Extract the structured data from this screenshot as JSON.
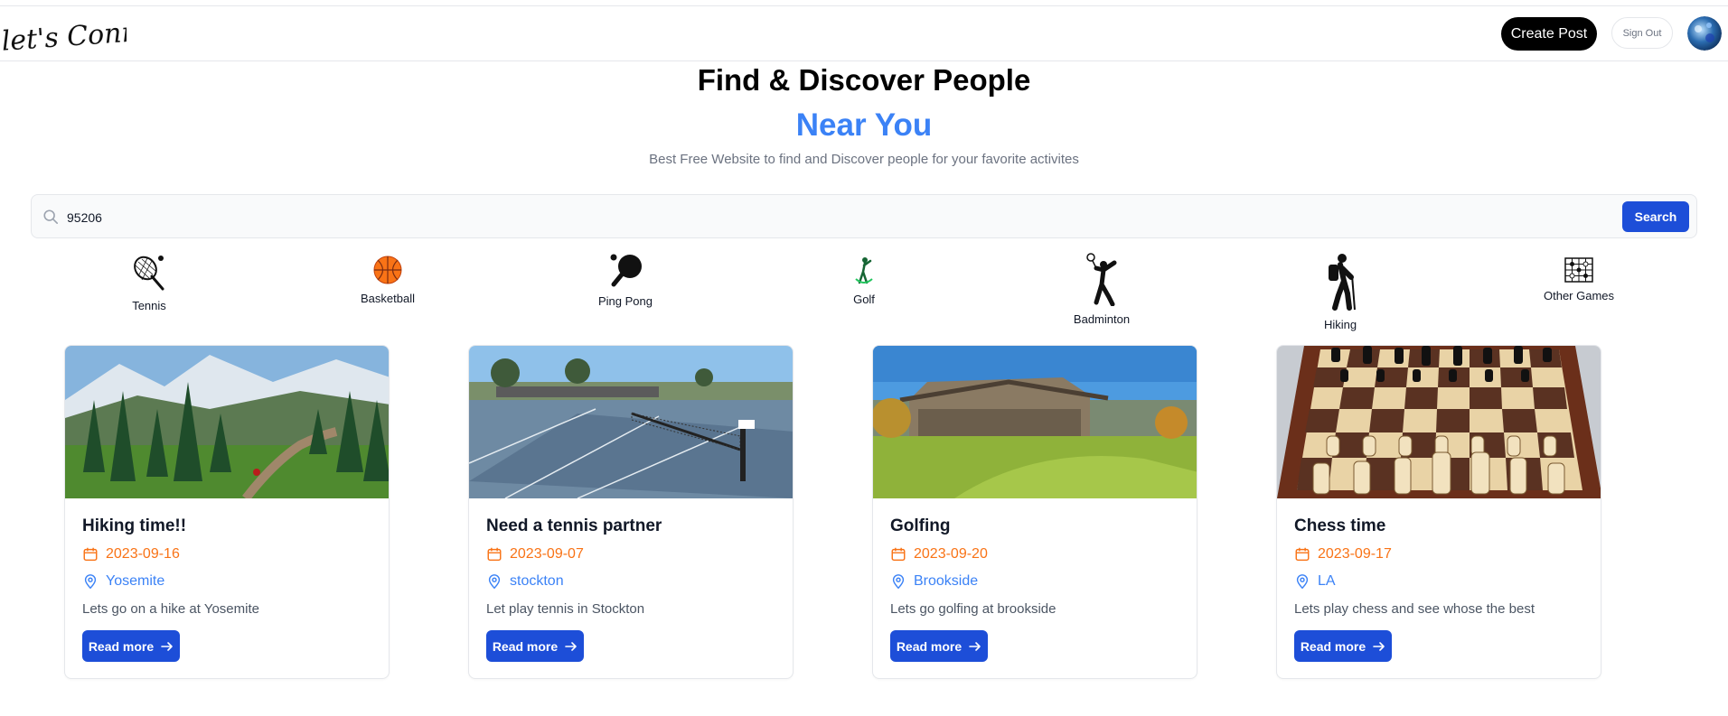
{
  "header": {
    "logo_text": "let's Connect!",
    "create_post_label": "Create Post",
    "sign_out_label": "Sign Out"
  },
  "hero": {
    "title": "Find & Discover People",
    "accent": "Near You",
    "subtitle": "Best Free Website to find and Discover people for your favorite activites"
  },
  "search": {
    "value": "95206",
    "button_label": "Search"
  },
  "categories": [
    {
      "label": "Tennis",
      "icon": "tennis-icon"
    },
    {
      "label": "Basketball",
      "icon": "basketball-icon"
    },
    {
      "label": "Ping Pong",
      "icon": "ping-pong-icon"
    },
    {
      "label": "Golf",
      "icon": "golf-icon"
    },
    {
      "label": "Badminton",
      "icon": "badminton-icon"
    },
    {
      "label": "Hiking",
      "icon": "hiking-icon"
    },
    {
      "label": "Other Games",
      "icon": "other-games-icon"
    }
  ],
  "posts": [
    {
      "title": "Hiking time!!",
      "date": "2023-09-16",
      "location": "Yosemite",
      "description": "Lets go on a hike at Yosemite",
      "button": "Read more"
    },
    {
      "title": "Need a tennis partner",
      "date": "2023-09-07",
      "location": "stockton",
      "description": "Let play tennis in Stockton",
      "button": "Read more"
    },
    {
      "title": "Golfing",
      "date": "2023-09-20",
      "location": "Brookside",
      "description": "Lets go golfing at brookside",
      "button": "Read more"
    },
    {
      "title": "Chess time",
      "date": "2023-09-17",
      "location": "LA",
      "description": "Lets play chess and see whose the best",
      "button": "Read more"
    }
  ],
  "colors": {
    "accent_blue": "#3b82f6",
    "button_blue": "#1d4ed8",
    "date_orange": "#f97316"
  }
}
